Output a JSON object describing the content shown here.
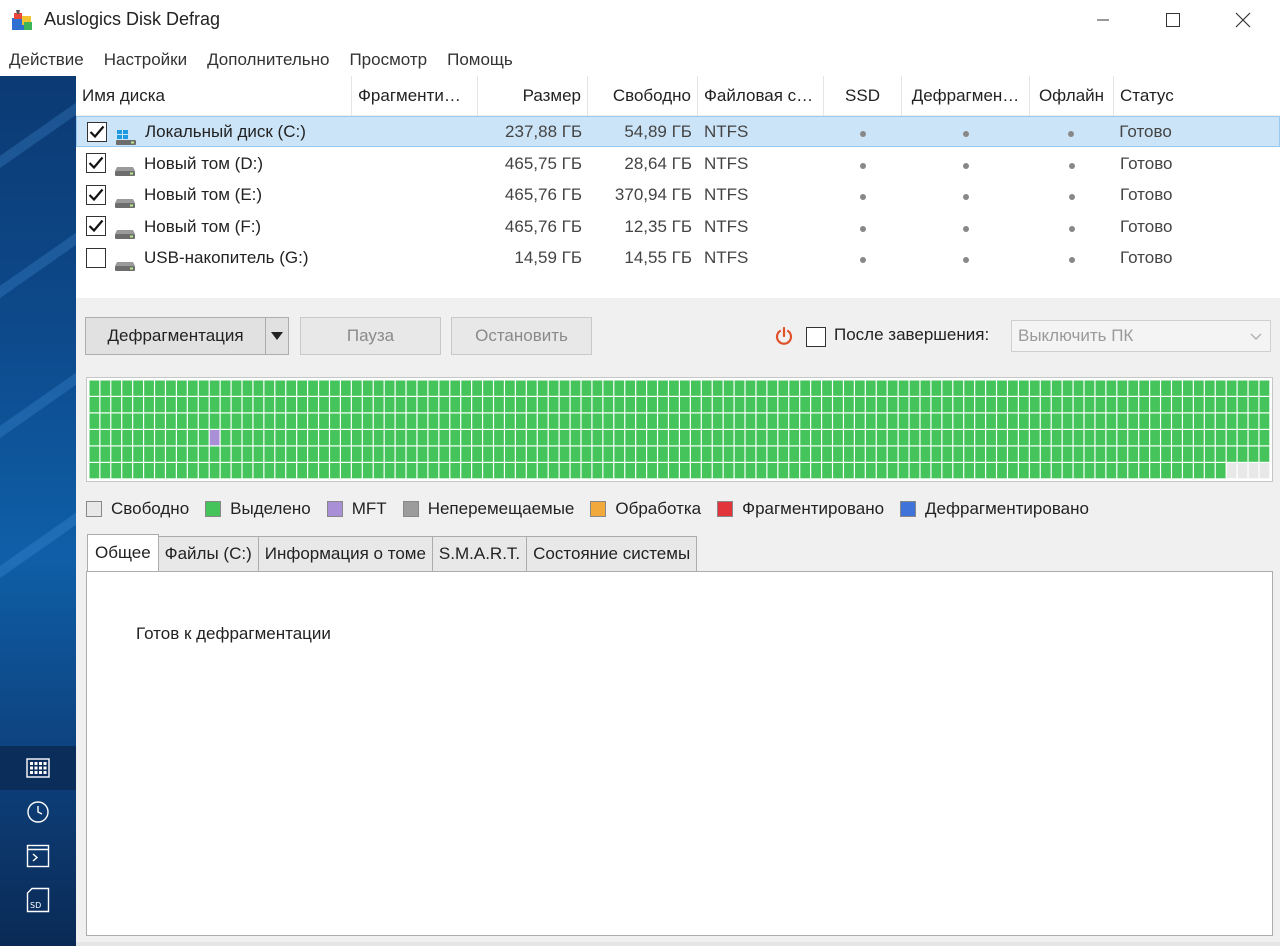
{
  "window": {
    "title": "Auslogics Disk Defrag"
  },
  "menu": [
    "Действие",
    "Настройки",
    "Дополнительно",
    "Просмотр",
    "Помощь"
  ],
  "table": {
    "headers": {
      "name": "Имя диска",
      "fragmented": "Фрагменти…",
      "size": "Размер",
      "free": "Свободно",
      "fs": "Файловая с…",
      "ssd": "SSD",
      "defrag": "Дефрагмен…",
      "offline": "Офлайн",
      "status": "Статус"
    },
    "rows": [
      {
        "checked": true,
        "name": "Локальный диск (C:)",
        "size": "237,88 ГБ",
        "free": "54,89 ГБ",
        "fs": "NTFS",
        "status": "Готово",
        "selected": true,
        "icon": "windows-drive-icon"
      },
      {
        "checked": true,
        "name": "Новый том (D:)",
        "size": "465,75 ГБ",
        "free": "28,64 ГБ",
        "fs": "NTFS",
        "status": "Готово",
        "selected": false,
        "icon": "hard-drive-icon"
      },
      {
        "checked": true,
        "name": "Новый том (E:)",
        "size": "465,76 ГБ",
        "free": "370,94 ГБ",
        "fs": "NTFS",
        "status": "Готово",
        "selected": false,
        "icon": "hard-drive-icon"
      },
      {
        "checked": true,
        "name": "Новый том (F:)",
        "size": "465,76 ГБ",
        "free": "12,35 ГБ",
        "fs": "NTFS",
        "status": "Готово",
        "selected": false,
        "icon": "hard-drive-icon"
      },
      {
        "checked": false,
        "name": "USB-накопитель (G:)",
        "size": "14,59 ГБ",
        "free": "14,55 ГБ",
        "fs": "NTFS",
        "status": "Готово",
        "selected": false,
        "icon": "hard-drive-icon"
      }
    ]
  },
  "controls": {
    "defrag_label": "Дефрагментация",
    "pause_label": "Пауза",
    "stop_label": "Остановить",
    "after_label": "После завершения:",
    "after_checked": false,
    "shutdown_value": "Выключить ПК"
  },
  "legend": [
    {
      "label": "Свободно",
      "color": "#e8e8e8"
    },
    {
      "label": "Выделено",
      "color": "#44c45a"
    },
    {
      "label": "MFT",
      "color": "#a98fd6"
    },
    {
      "label": "Неперемещаемые",
      "color": "#9c9c9c"
    },
    {
      "label": "Обработка",
      "color": "#f2a93b"
    },
    {
      "label": "Фрагментировано",
      "color": "#e2353b"
    },
    {
      "label": "Дефрагментировано",
      "color": "#3f73d9"
    }
  ],
  "cluster_map": {
    "mft_fraction": 0.002,
    "free_fraction": 0.006
  },
  "tabs": [
    "Общее",
    "Файлы (C:)",
    "Информация о томе",
    "S.M.A.R.T.",
    "Состояние системы"
  ],
  "active_tab": 0,
  "panel": {
    "status_text": "Готов к дефрагментации"
  },
  "colors": {
    "accent": "#0f5fa8",
    "selection": "#cce4f7",
    "power": "#e0502a"
  }
}
